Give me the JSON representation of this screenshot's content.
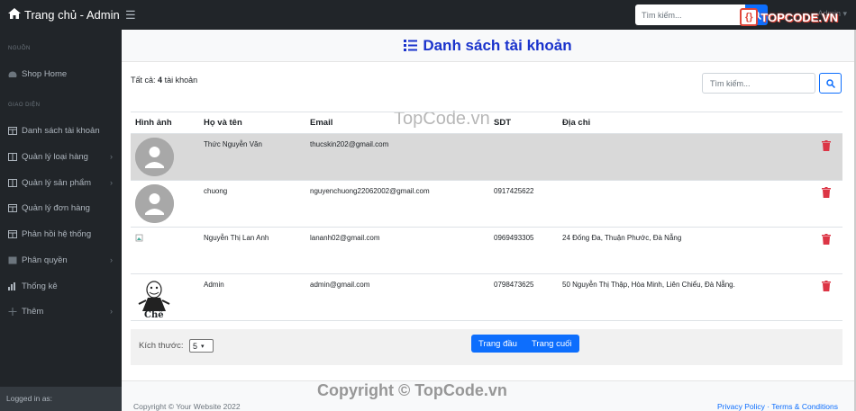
{
  "navbar": {
    "brand": "Trang chủ - Admin",
    "search_placeholder": "Tìm kiếm...",
    "user_label": "Admin ▾"
  },
  "watermark": {
    "logo_text": "TOPCODE.VN",
    "mid_text": "TopCode.vn",
    "copyright_text": "Copyright © TopCode.vn"
  },
  "sidebar": {
    "heading_nguon": "NGUỒN",
    "heading_giaodien": "GIAO DIỆN",
    "items": [
      {
        "label": "Shop Home",
        "icon": "gauge-icon"
      },
      {
        "label": "Danh sách tài khoản",
        "icon": "table-icon"
      },
      {
        "label": "Quản lý loại hàng",
        "icon": "columns-icon"
      },
      {
        "label": "Quản lý sản phẩm",
        "icon": "columns-icon"
      },
      {
        "label": "Quản lý đơn hàng",
        "icon": "table-icon"
      },
      {
        "label": "Phản hồi hệ thống",
        "icon": "table-icon"
      },
      {
        "label": "Phân quyền",
        "icon": "columns-icon"
      },
      {
        "label": "Thống kê",
        "icon": "chart-icon"
      },
      {
        "label": "Thêm",
        "icon": "plus-icon"
      }
    ],
    "footer_label": "Logged in as:"
  },
  "main": {
    "title": "Danh sách tài khoản",
    "count_prefix": "Tất cả:",
    "count_value": "4",
    "count_suffix": "tài khoản",
    "search_placeholder": "Tìm kiếm...",
    "columns": [
      "Hình ảnh",
      "Họ và tên",
      "Email",
      "SDT",
      "Địa chỉ"
    ],
    "rows": [
      {
        "name": "Thức Nguyễn Văn",
        "email": "thucskin202@gmail.com",
        "phone": "",
        "address": ""
      },
      {
        "name": "chuong",
        "email": "nguyenchuong22062002@gmail.com",
        "phone": "0917425622",
        "address": ""
      },
      {
        "name": "Nguyễn Thị Lan Anh",
        "email": "lananh02@gmail.com",
        "phone": "0969493305",
        "address": "24 Đống Đa, Thuận Phước, Đà Nẵng"
      },
      {
        "name": "Admin",
        "email": "admin@gmail.com",
        "phone": "0798473625",
        "address": "50 Nguyễn Thị Thập, Hòa Minh, Liên Chiểu, Đà Nẵng."
      }
    ],
    "meme_caption": "Chê",
    "page_size_label": "Kích thước:",
    "page_size_value": "5",
    "btn_first": "Trang đầu",
    "btn_last": "Trang cuối"
  },
  "footer": {
    "copyright": "Copyright © Your Website 2022",
    "links": "Privacy Policy · Terms & Conditions"
  },
  "colors": {
    "accent": "#0d6efd",
    "title": "#1a33cc",
    "delete": "#dc3545",
    "sidebar_bg": "#212529"
  }
}
